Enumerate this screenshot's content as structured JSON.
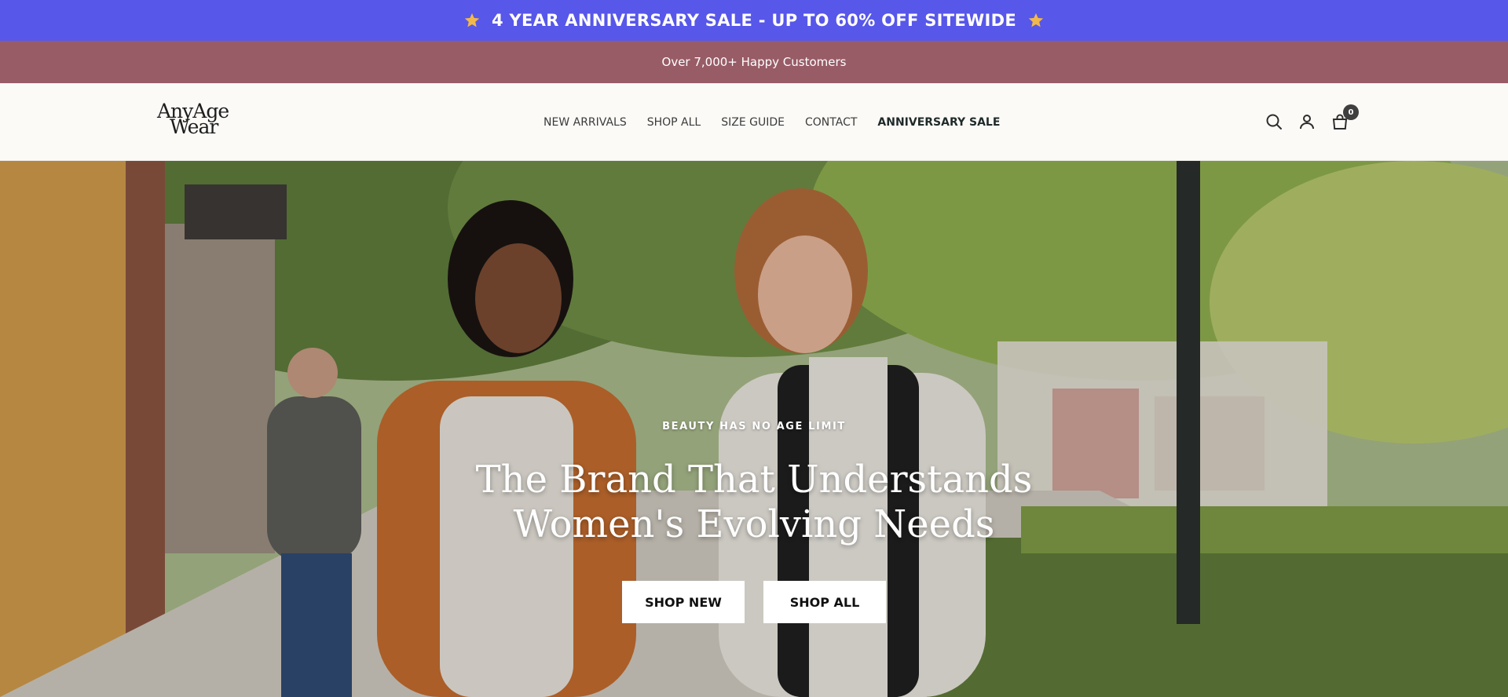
{
  "announcement": {
    "text": "4 YEAR ANNIVERSARY SALE - UP TO 60% OFF SITEWIDE",
    "icon": "star-icon",
    "color": "#5757ea"
  },
  "subbar": {
    "text": "Over 7,000+ Happy Customers",
    "color": "#985c66"
  },
  "header": {
    "logo": {
      "line1": "AnyAge",
      "line2": "Wear"
    },
    "nav": [
      {
        "label": "NEW ARRIVALS"
      },
      {
        "label": "SHOP ALL"
      },
      {
        "label": "SIZE GUIDE"
      },
      {
        "label": "CONTACT"
      },
      {
        "label": "ANNIVERSARY SALE"
      }
    ],
    "icons": [
      "search-icon",
      "account-icon",
      "cart-icon"
    ],
    "cart_count": "0"
  },
  "hero": {
    "eyebrow": "BEAUTY HAS NO AGE LIMIT",
    "headline": "The Brand That Understands Women's Evolving Needs",
    "buttons": [
      {
        "label": "SHOP NEW"
      },
      {
        "label": "SHOP ALL"
      }
    ]
  }
}
